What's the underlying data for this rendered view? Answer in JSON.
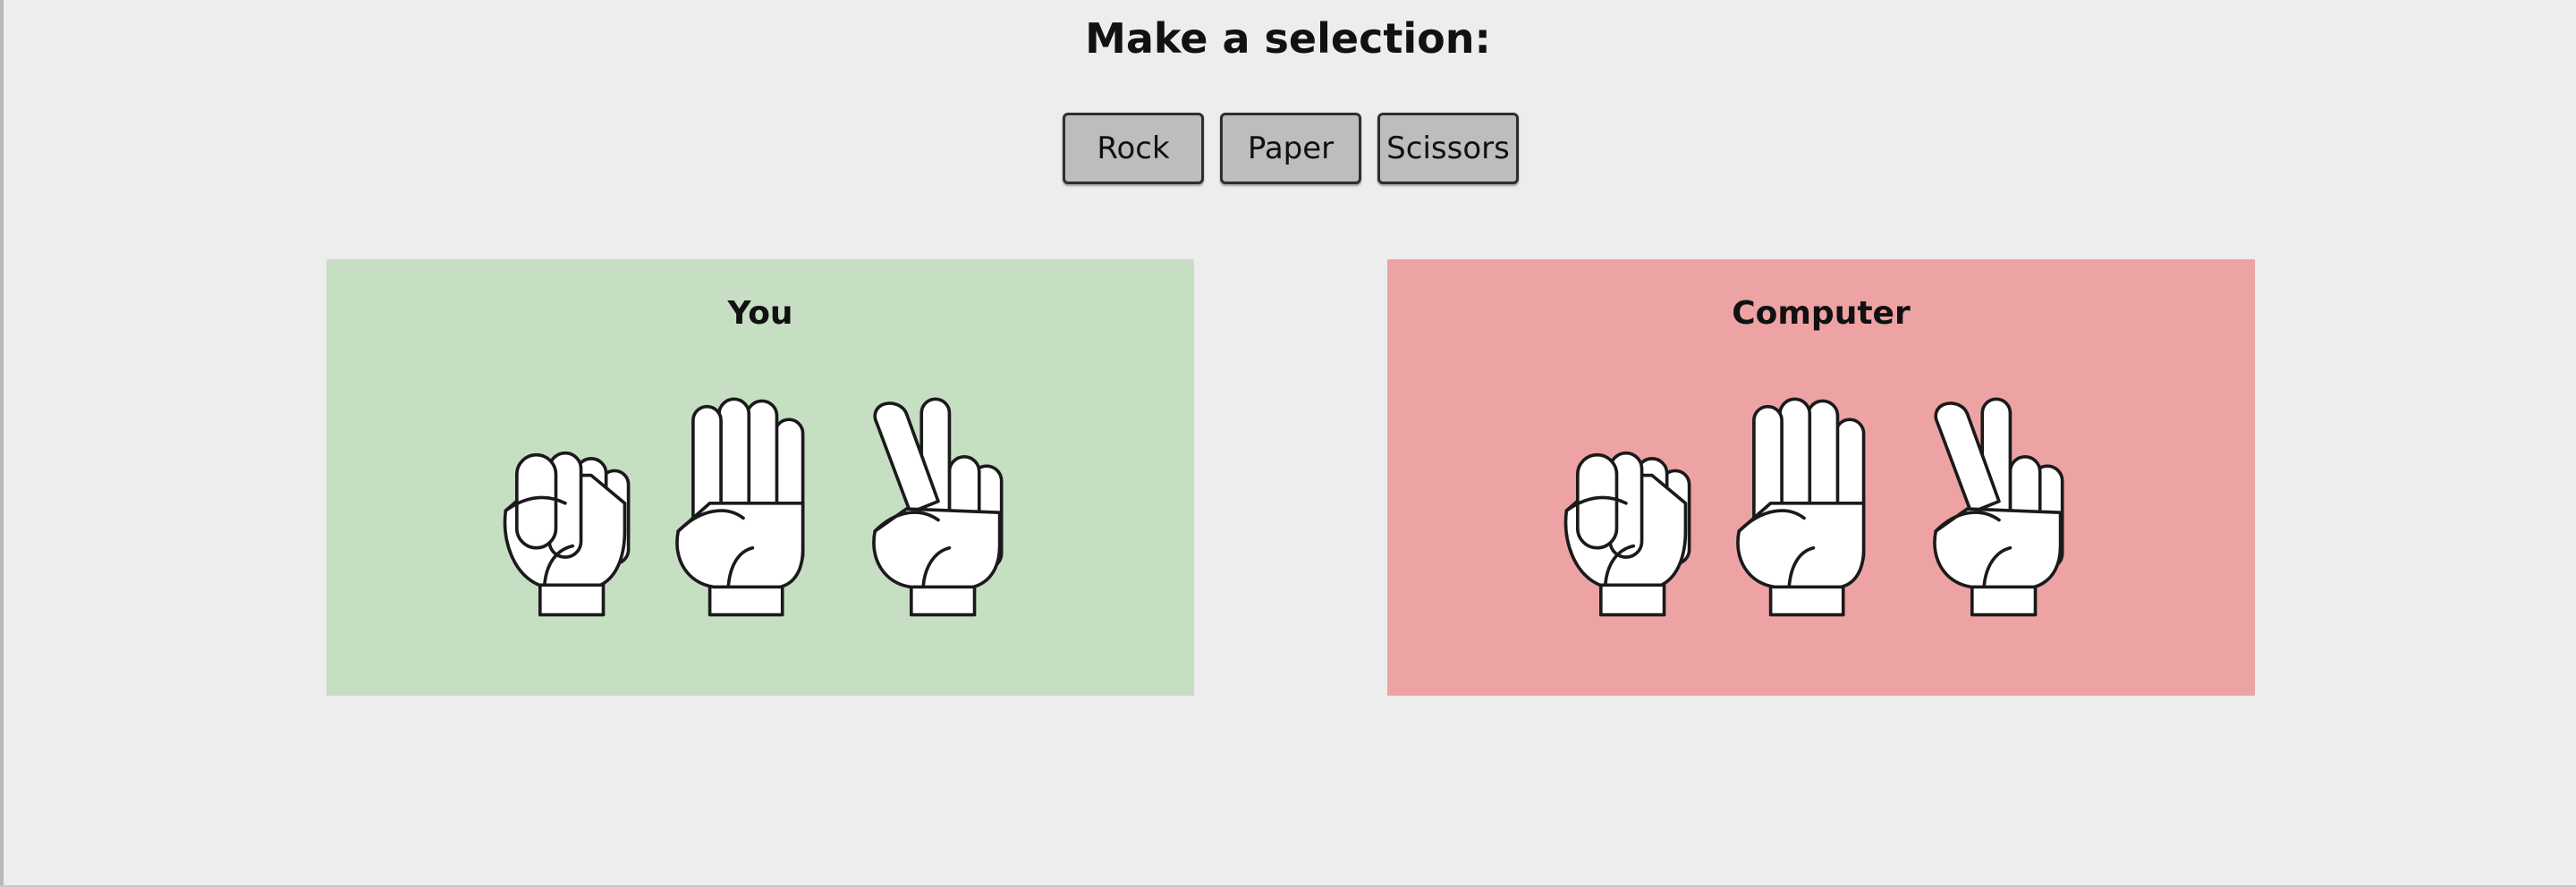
{
  "heading": "Make a selection:",
  "buttons": {
    "rock": "Rock",
    "paper": "Paper",
    "scissors": "Scissors"
  },
  "panels": {
    "player": {
      "title": "You",
      "color": "#c6dfc3",
      "icons": [
        "rock-icon",
        "paper-icon",
        "scissors-icon"
      ]
    },
    "computer": {
      "title": "Computer",
      "color": "#eda3a3",
      "icons": [
        "rock-icon",
        "paper-icon",
        "scissors-icon"
      ]
    }
  }
}
